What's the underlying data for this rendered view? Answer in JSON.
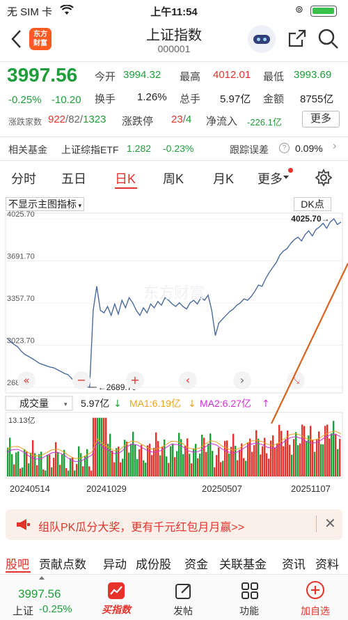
{
  "status_bar": {
    "carrier": "无 SIM 卡",
    "wifi_icon": "wifi-icon",
    "time": "上午11:54",
    "battery_icon": "battery-icon"
  },
  "header": {
    "title": "上证指数",
    "code": "000001",
    "back_icon": "back-chevron-icon",
    "logo_text_line1": "东方",
    "logo_text_line2": "财富",
    "share_icon": "share-icon",
    "search_icon": "search-icon",
    "avatar_icon": "robot-avatar-icon"
  },
  "quote": {
    "price": "3997.56",
    "change_pct": "-0.25%",
    "change_abs": "-10.20",
    "open_label": "今开",
    "open_value": "3994.32",
    "high_label": "最高",
    "high_value": "4012.01",
    "low_label": "最低",
    "low_value": "3993.69",
    "turnover_label": "换手",
    "turnover_value": "1.26%",
    "volume_label": "总手",
    "volume_value": "5.97亿",
    "amount_label": "金额",
    "amount_value": "8755亿",
    "breadth_label": "涨跌家数",
    "breadth_up": "922",
    "breadth_flat": "82",
    "breadth_down": "1323",
    "limit_label": "涨跌停",
    "limit_up": "23",
    "limit_down": "4",
    "netflow_label": "净流入",
    "netflow_value": "-226.1亿",
    "more_label": "更多"
  },
  "fund": {
    "label": "相关基金",
    "name": "上证综指ETF",
    "price": "1.282",
    "change": "-0.23%",
    "track_label": "跟踪误差",
    "track_value": "0.09%"
  },
  "period_tabs": [
    {
      "label": "分时"
    },
    {
      "label": "五日"
    },
    {
      "label": "日K"
    },
    {
      "label": "周K"
    },
    {
      "label": "月K"
    },
    {
      "label": "更多"
    }
  ],
  "chart_controls": {
    "indicator_select": "不显示主图指标",
    "dk_label": "DK点"
  },
  "chart_data": {
    "type": "line",
    "y_ticks": [
      "4025.70",
      "3691.70",
      "3357.70",
      "3023.70",
      "2689.70"
    ],
    "ylim": [
      2689.7,
      4025.7
    ],
    "min_annotation": "2689.70",
    "max_annotation": "4025.70",
    "x_ticks": [
      "20240514",
      "20241029",
      "20250507",
      "20251107"
    ],
    "price_series": [
      3080,
      3050,
      3030,
      3010,
      2975,
      2950,
      2935,
      2918,
      2900,
      2880,
      2870,
      2860,
      2850,
      2845,
      2830,
      2815,
      2800,
      2790,
      2760,
      2735,
      2720,
      2700,
      2695,
      2690,
      3300,
      3490,
      3300,
      3280,
      3330,
      3260,
      3350,
      3270,
      3380,
      3320,
      3400,
      3360,
      3300,
      3260,
      3320,
      3280,
      3350,
      3320,
      3370,
      3340,
      3400,
      3380,
      3350,
      3330,
      3360,
      3330,
      3310,
      3360,
      3380,
      3350,
      3400,
      3380,
      3420,
      3300,
      3100,
      3200,
      3230,
      3260,
      3290,
      3310,
      3340,
      3360,
      3390,
      3380,
      3410,
      3450,
      3500,
      3490,
      3550,
      3600,
      3640,
      3680,
      3740,
      3770,
      3790,
      3830,
      3860,
      3880,
      3850,
      3900,
      3930,
      3890,
      3940,
      3960,
      3990,
      3950,
      4000,
      4025,
      3980,
      4000
    ],
    "volume_label": "成交量",
    "volume_value": "5.97亿",
    "ma1_label": "MA1:6.19亿",
    "ma2_label": "MA2:6.27亿",
    "volume_max_label": "13.13亿"
  },
  "banner": {
    "text": "组队PK瓜分大奖，更有千元红包月月赢>>"
  },
  "sub_tabs": [
    "股吧",
    "贡献点数",
    "异动",
    "成份股",
    "资金",
    "关联基金",
    "资讯",
    "资料"
  ],
  "bottom_nav": {
    "mini_price": "3997.56",
    "mini_name": "上证",
    "mini_change": "-0.25%",
    "items": [
      {
        "label": "买指数",
        "icon": "chart-up-icon"
      },
      {
        "label": "发帖",
        "icon": "edit-icon"
      },
      {
        "label": "功能",
        "icon": "grid-icon"
      },
      {
        "label": "加自选",
        "icon": "plus-circle-icon"
      }
    ]
  },
  "colors": {
    "up": "#e5332c",
    "down": "#1e9e3a",
    "line": "#4a6a9c",
    "accent": "#ff5a1f"
  }
}
